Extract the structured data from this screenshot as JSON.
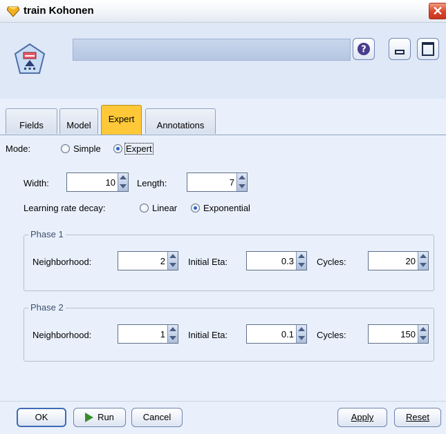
{
  "window": {
    "title": "train Kohonen",
    "close_glyph": "✕"
  },
  "header": {
    "help_glyph": "?"
  },
  "tabs": [
    {
      "label": "Fields"
    },
    {
      "label": "Model"
    },
    {
      "label": "Expert"
    },
    {
      "label": "Annotations"
    }
  ],
  "active_tab": "Expert",
  "mode": {
    "label": "Mode:",
    "simple": "Simple",
    "expert": "Expert",
    "selected": "Expert"
  },
  "size": {
    "width_label": "Width:",
    "width_value": "10",
    "length_label": "Length:",
    "length_value": "7"
  },
  "decay": {
    "label": "Learning rate decay:",
    "linear": "Linear",
    "exponential": "Exponential",
    "selected": "Exponential"
  },
  "phase1": {
    "title": "Phase 1",
    "neighborhood_label": "Neighborhood:",
    "neighborhood_value": "2",
    "eta_label": "Initial Eta:",
    "eta_value": "0.3",
    "cycles_label": "Cycles:",
    "cycles_value": "20"
  },
  "phase2": {
    "title": "Phase 2",
    "neighborhood_label": "Neighborhood:",
    "neighborhood_value": "1",
    "eta_label": "Initial Eta:",
    "eta_value": "0.1",
    "cycles_label": "Cycles:",
    "cycles_value": "150"
  },
  "buttons": {
    "ok": "OK",
    "run": "Run",
    "cancel": "Cancel",
    "apply": "Apply",
    "reset": "Reset"
  },
  "colors": {
    "active_tab": "#ffc838",
    "close": "#d9452a",
    "run": "#3a8d2c",
    "selected_radio": "#2762c8"
  }
}
